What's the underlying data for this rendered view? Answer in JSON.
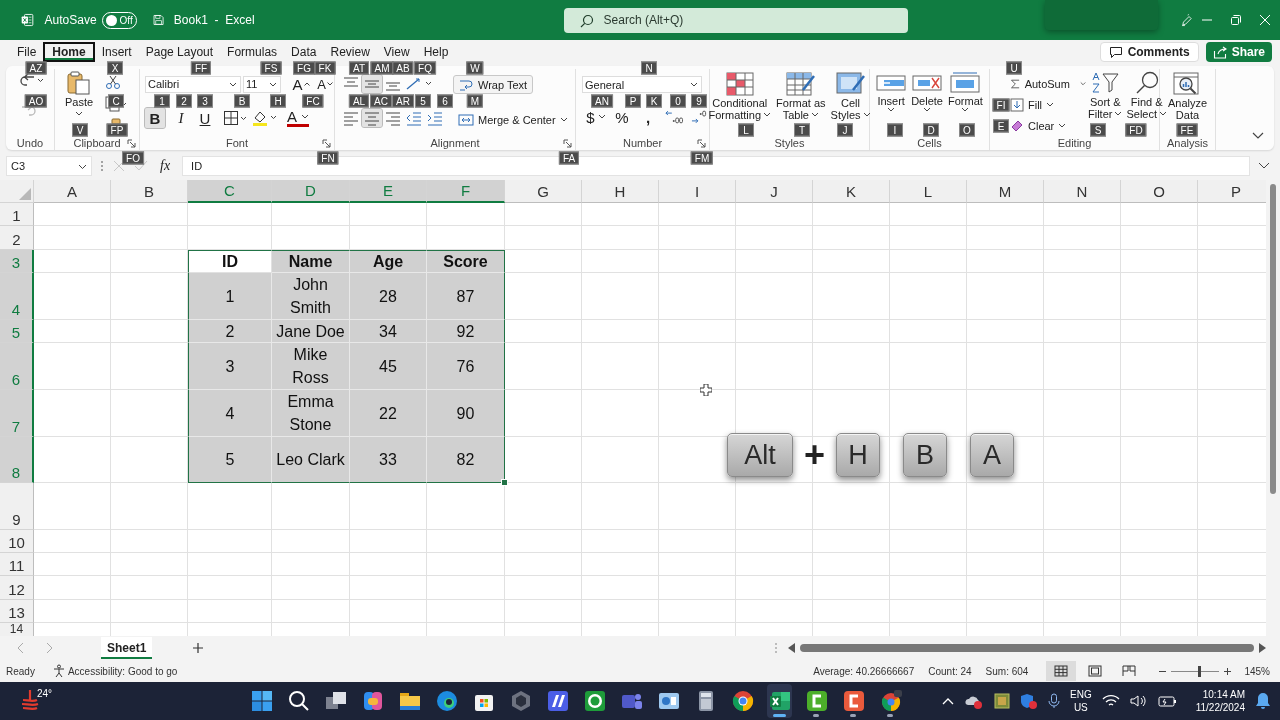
{
  "title_bar": {
    "autosave_label": "AutoSave",
    "autosave": {
      "on": false,
      "label": "Off"
    },
    "document_title": "Book1  -  Excel",
    "search": {
      "placeholder": "Search (Alt+Q)"
    }
  },
  "tabs": [
    {
      "label": "File",
      "selected": false
    },
    {
      "label": "Home",
      "selected": true
    },
    {
      "label": "Insert",
      "selected": false
    },
    {
      "label": "Page Layout",
      "selected": false
    },
    {
      "label": "Formulas",
      "selected": false
    },
    {
      "label": "Data",
      "selected": false
    },
    {
      "label": "Review",
      "selected": false
    },
    {
      "label": "View",
      "selected": false
    },
    {
      "label": "Help",
      "selected": false
    }
  ],
  "comments_button": "Comments",
  "share_button": "Share",
  "ribbon": {
    "undo": {
      "label": "Undo",
      "keytips": [
        "AZ",
        "AO"
      ]
    },
    "clipboard": {
      "label": "Clipboard",
      "paste": "Paste",
      "keytips": [
        "X",
        "C",
        "V",
        "FP",
        "FO"
      ]
    },
    "font": {
      "label": "Font",
      "family": "Calibri",
      "size": "11",
      "grow": "A",
      "shrink": "A",
      "bold": {
        "label": "B",
        "on": true
      },
      "italic": "I",
      "underline": "U",
      "text_glyph": "A",
      "keytips": [
        "FF",
        "FS",
        "FG",
        "FK",
        "1",
        "2",
        "3",
        "B",
        "H",
        "FC",
        "FN"
      ]
    },
    "alignment": {
      "label": "Alignment",
      "wrap_text": "Wrap Text",
      "merge": "Merge & Center",
      "middle_on": true,
      "center_on": true,
      "keytips": [
        "AT",
        "AM",
        "AB",
        "FQ",
        "W",
        "AL",
        "AC",
        "AR",
        "5",
        "6",
        "M",
        "FA"
      ]
    },
    "number": {
      "label": "Number",
      "format": "General",
      "currency": "$",
      "percent": "%",
      "comma": ",",
      "keytips": [
        "N",
        "AN",
        "P",
        "K",
        "0",
        "9",
        "FM"
      ]
    },
    "styles": {
      "label": "Styles",
      "conditional": [
        "Conditional",
        "Formatting"
      ],
      "table": [
        "Format as",
        "Table"
      ],
      "cell_styles": [
        "Cell",
        "Styles"
      ],
      "keytips": [
        "L",
        "T",
        "J"
      ]
    },
    "cells": {
      "label": "Cells",
      "insert": "Insert",
      "delete": "Delete",
      "format": "Format",
      "keytips": [
        "I",
        "D",
        "O"
      ]
    },
    "editing": {
      "label": "Editing",
      "autosum": "AutoSum",
      "fill": "Fill",
      "clear": "Clear",
      "sort": [
        "Sort &",
        "Filter"
      ],
      "find": [
        "Find &",
        "Select"
      ],
      "keytips": [
        "U",
        "FI",
        "E",
        "S",
        "FD"
      ]
    },
    "analysis": {
      "label": "Analysis",
      "analyze": [
        "Analyze",
        "Data"
      ],
      "keytips": [
        "FE"
      ]
    }
  },
  "formula_bar": {
    "name_box": "C3",
    "fx": "fx",
    "value": "ID"
  },
  "sheet": {
    "columns": [
      {
        "label": "A",
        "selected": false
      },
      {
        "label": "B",
        "selected": false
      },
      {
        "label": "C",
        "selected": true
      },
      {
        "label": "D",
        "selected": true
      },
      {
        "label": "E",
        "selected": true
      },
      {
        "label": "F",
        "selected": true
      },
      {
        "label": "G",
        "selected": false
      },
      {
        "label": "H",
        "selected": false
      },
      {
        "label": "I",
        "selected": false
      },
      {
        "label": "J",
        "selected": false
      },
      {
        "label": "K",
        "selected": false
      },
      {
        "label": "L",
        "selected": false
      },
      {
        "label": "M",
        "selected": false
      },
      {
        "label": "N",
        "selected": false
      },
      {
        "label": "O",
        "selected": false
      },
      {
        "label": "P",
        "selected": false
      }
    ],
    "rows": [
      {
        "label": "1",
        "selected": false
      },
      {
        "label": "2",
        "selected": false
      },
      {
        "label": "3",
        "selected": true,
        "kind": "header",
        "cells": [
          {
            "text": "ID",
            "active": true
          },
          {
            "text": "Name",
            "active": false
          },
          {
            "text": "Age",
            "active": false
          },
          {
            "text": "Score",
            "active": false
          }
        ]
      },
      {
        "label": "4",
        "selected": true,
        "kind": "data",
        "cells": [
          {
            "text": "1",
            "active": false
          },
          {
            "text": "John Smith",
            "active": false
          },
          {
            "text": "28",
            "active": false
          },
          {
            "text": "87",
            "active": false
          }
        ]
      },
      {
        "label": "5",
        "selected": true,
        "kind": "data",
        "cells": [
          {
            "text": "2",
            "active": false
          },
          {
            "text": "Jane Doe",
            "active": false
          },
          {
            "text": "34",
            "active": false
          },
          {
            "text": "92",
            "active": false
          }
        ]
      },
      {
        "label": "6",
        "selected": true,
        "kind": "data",
        "cells": [
          {
            "text": "3",
            "active": false
          },
          {
            "text": "Mike Ross",
            "active": false
          },
          {
            "text": "45",
            "active": false
          },
          {
            "text": "76",
            "active": false
          }
        ]
      },
      {
        "label": "7",
        "selected": true,
        "kind": "data",
        "cells": [
          {
            "text": "4",
            "active": false
          },
          {
            "text": "Emma Stone",
            "active": false
          },
          {
            "text": "22",
            "active": false
          },
          {
            "text": "90",
            "active": false
          }
        ]
      },
      {
        "label": "8",
        "selected": true,
        "kind": "data",
        "cells": [
          {
            "text": "5",
            "active": false
          },
          {
            "text": "Leo Clark",
            "active": false
          },
          {
            "text": "33",
            "active": false
          },
          {
            "text": "82",
            "active": false
          }
        ]
      },
      {
        "label": "9",
        "selected": false
      },
      {
        "label": "10",
        "selected": false
      },
      {
        "label": "11",
        "selected": false
      },
      {
        "label": "12",
        "selected": false
      },
      {
        "label": "13",
        "selected": false
      },
      {
        "label": "14",
        "selected": false
      }
    ]
  },
  "shortcut_keys": [
    {
      "kind": "key",
      "label": "Alt"
    },
    {
      "kind": "plus",
      "label": "+"
    },
    {
      "kind": "key",
      "label": "H"
    },
    {
      "kind": "key",
      "label": "B"
    },
    {
      "kind": "key",
      "label": "A"
    }
  ],
  "sheet_tabs": [
    {
      "label": "Sheet1",
      "selected": true
    }
  ],
  "status_bar": {
    "ready": "Ready",
    "accessibility": "Accessibility: Good to go",
    "average": "Average: 40.26666667",
    "count": "Count: 24",
    "sum": "Sum: 604",
    "views": [
      {
        "selected": true
      },
      {
        "selected": false
      },
      {
        "selected": false
      }
    ],
    "zoom": {
      "level": 0.58,
      "reading": "145%"
    }
  },
  "taskbar": {
    "weather": "24°",
    "apps": [
      {
        "running": false,
        "selected": false
      },
      {
        "running": false,
        "selected": false
      },
      {
        "running": false,
        "selected": false
      },
      {
        "running": false,
        "selected": false
      },
      {
        "running": false,
        "selected": false
      },
      {
        "running": false,
        "selected": false
      },
      {
        "running": false,
        "selected": false
      },
      {
        "running": false,
        "selected": false
      },
      {
        "running": false,
        "selected": false
      },
      {
        "running": false,
        "selected": false
      },
      {
        "running": false,
        "selected": false
      },
      {
        "running": false,
        "selected": false
      },
      {
        "running": false,
        "selected": false
      },
      {
        "running": false,
        "selected": false
      },
      {
        "running": true,
        "selected": true
      },
      {
        "running": true,
        "selected": false
      },
      {
        "running": true,
        "selected": false
      },
      {
        "running": true,
        "selected": false
      }
    ],
    "language": [
      "ENG",
      "US"
    ],
    "time": "10:14 AM",
    "date": "11/22/2024"
  }
}
